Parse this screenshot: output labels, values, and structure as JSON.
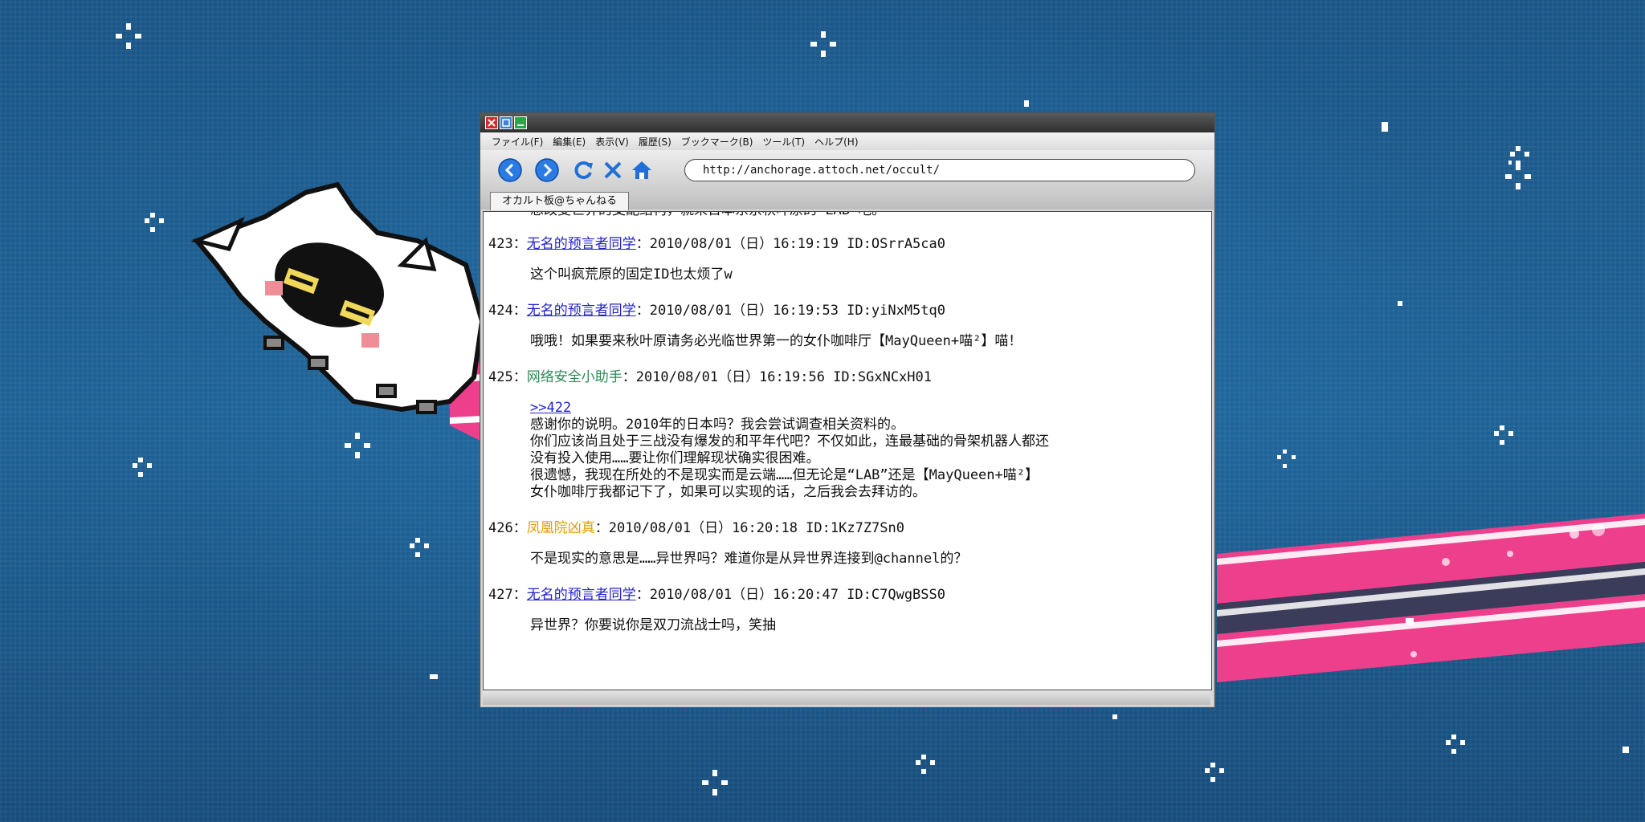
{
  "browser": {
    "menu": [
      "ファイル(F)",
      "編集(E)",
      "表示(V)",
      "履歴(S)",
      "ブックマーク(B)",
      "ツール(T)",
      "ヘルプ(H)"
    ],
    "url": "http://anchorage.attoch.net/occult/",
    "tab_title": "オカルト板@ちゃんねる"
  },
  "thread": {
    "partial_line": "想改变世界的支配结构，就来日本东京秋叶原的“LAB”吧。",
    "posts": [
      {
        "number": "423：",
        "name": "无名的预言者同学",
        "name_style": "link",
        "meta": "：2010/08/01（日）16:19:19 ID:OSrrA5ca0",
        "body": [
          "这个叫疯荒原的固定ID也太烦了w"
        ]
      },
      {
        "number": "424：",
        "name": "无名的预言者同学",
        "name_style": "link",
        "meta": "：2010/08/01（日）16:19:53 ID:yiNxM5tq0",
        "body": [
          "哦哦！如果要来秋叶原请务必光临世界第一的女仆咖啡厅【MayQueen+喵²】喵！"
        ]
      },
      {
        "number": "425：",
        "name": "网络安全小助手",
        "name_style": "green",
        "meta": "：2010/08/01（日）16:19:56 ID:SGxNCxH01",
        "reply": ">>422",
        "body": [
          "感谢你的说明。2010年的日本吗？我会尝试调查相关资料的。",
          "你们应该尚且处于三战没有爆发的和平年代吧？不仅如此，连最基础的骨架机器人都还",
          "没有投入使用……要让你们理解现状确实很困难。",
          "很遗憾，我现在所处的不是现实而是云端……但无论是“LAB”还是【MayQueen+喵²】",
          "女仆咖啡厅我都记下了，如果可以实现的话，之后我会去拜访的。"
        ]
      },
      {
        "number": "426：",
        "name": "凤凰院凶真",
        "name_style": "orange",
        "meta": "：2010/08/01（日）16:20:18 ID:1Kz7Z7Sn0",
        "body": [
          "不是现实的意思是……异世界吗？难道你是从异世界连接到@channel的？"
        ]
      },
      {
        "number": "427：",
        "name": "无名的预言者同学",
        "name_style": "link",
        "meta": "：2010/08/01（日）16:20:47 ID:C7QwgBSS0",
        "body": [
          "异世界？你要说你是双刀流战士吗，笑抽"
        ]
      }
    ]
  },
  "colors": {
    "background": "#1d5c8e",
    "link": "#2323c9",
    "green_name": "#2b8a57",
    "orange_name": "#e0a000",
    "rainbow_pink": "#ee3f8c"
  },
  "icons": {
    "back": "back-arrow-icon",
    "forward": "forward-arrow-icon",
    "reload": "reload-icon",
    "stop": "stop-x-icon",
    "home": "home-icon"
  }
}
